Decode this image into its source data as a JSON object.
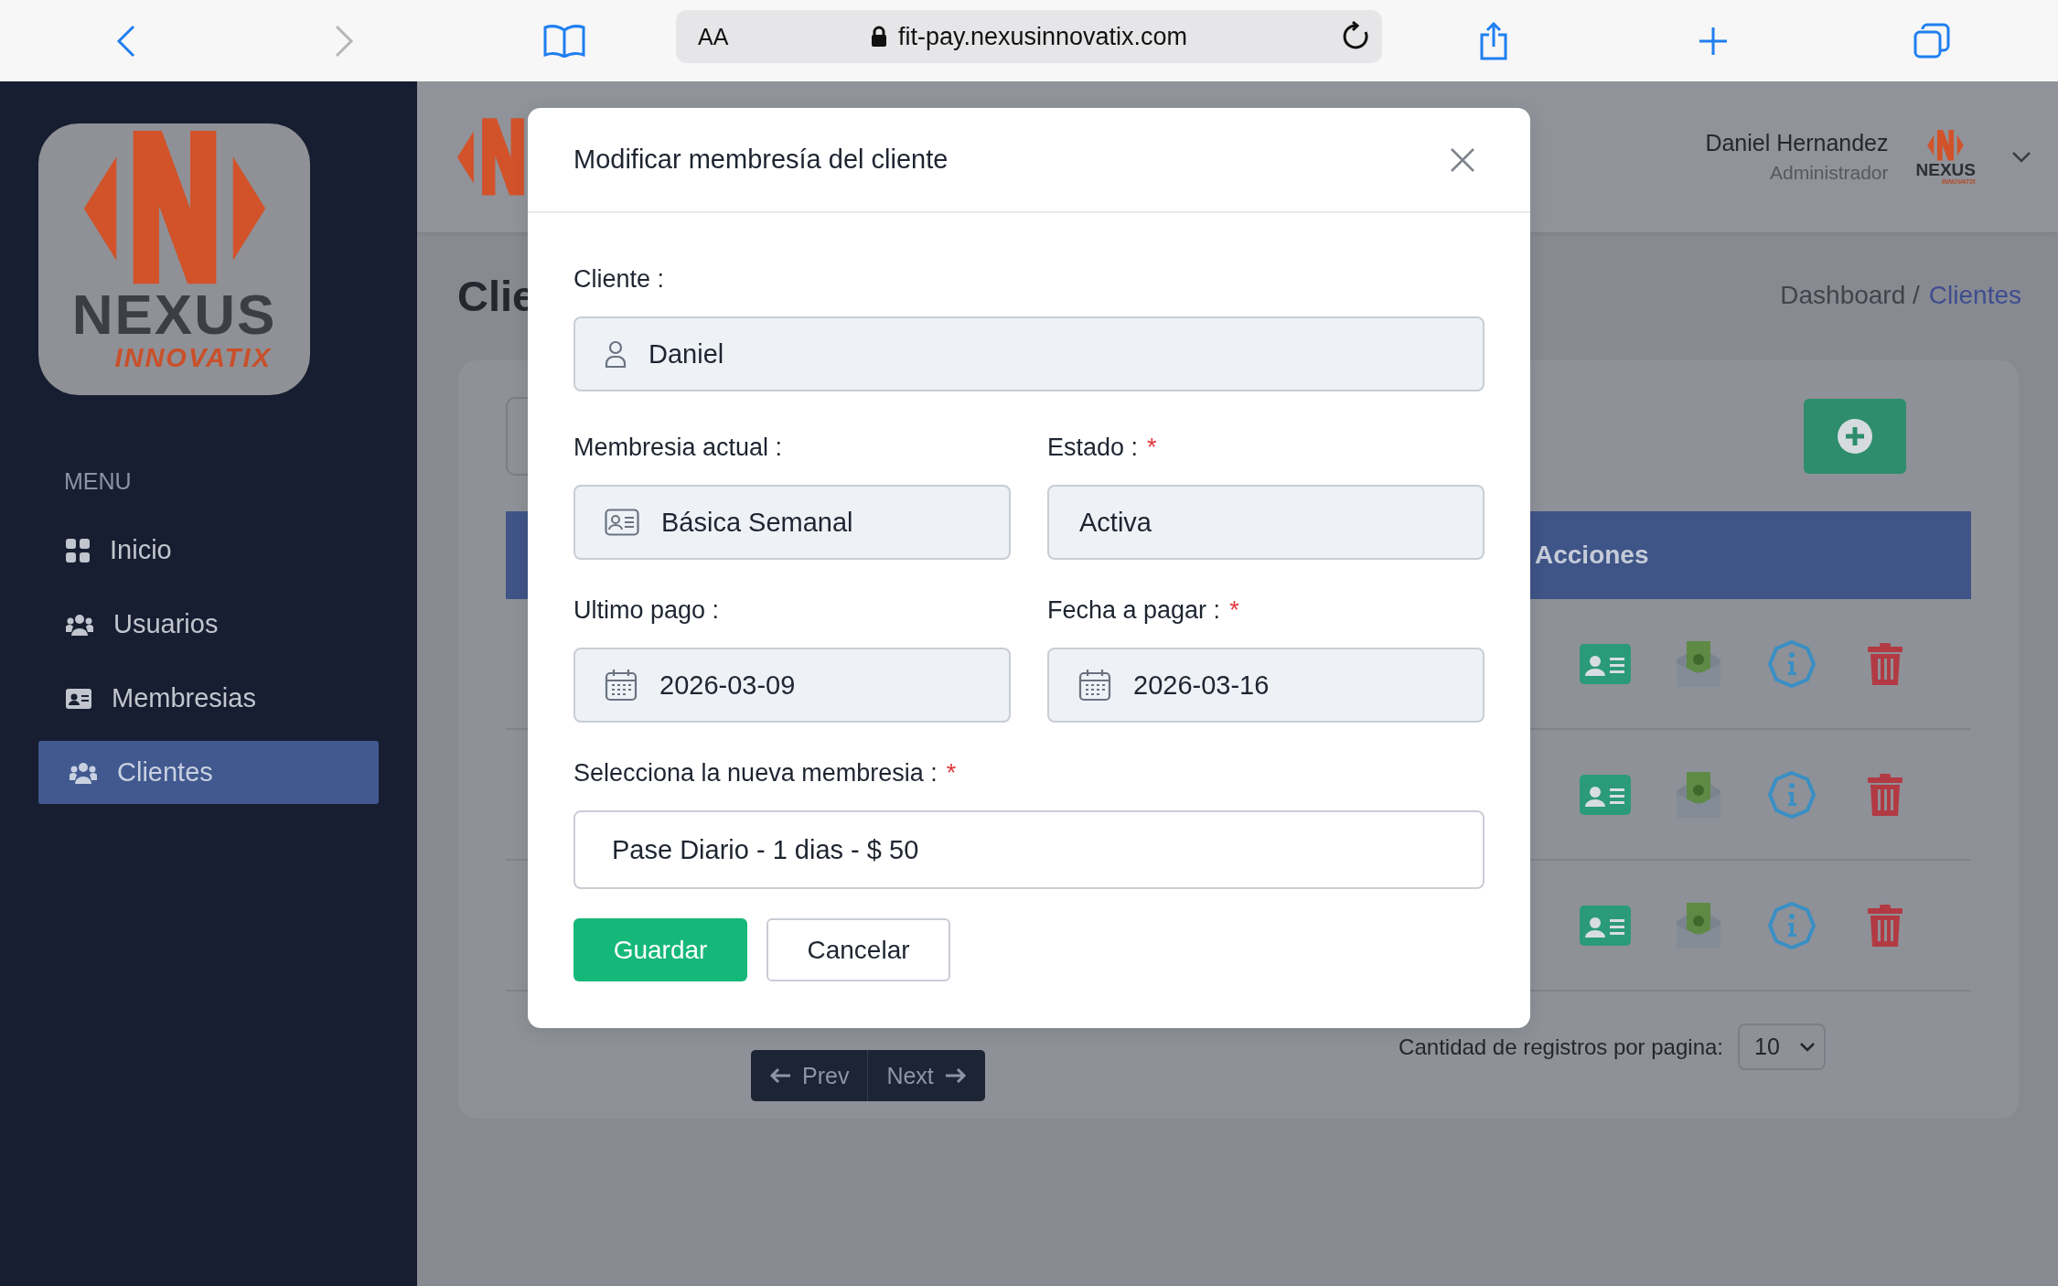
{
  "browser": {
    "text_size_button": "AA",
    "url": "fit-pay.nexusinnovatix.com"
  },
  "sidebar": {
    "logo": {
      "wordmark": "NEXUS",
      "tagline": "INNOVATIX"
    },
    "menu_heading": "MENU",
    "items": [
      {
        "label": "Inicio",
        "selected": false
      },
      {
        "label": "Usuarios",
        "selected": false
      },
      {
        "label": "Membresias",
        "selected": false
      },
      {
        "label": "Clientes",
        "selected": true
      }
    ]
  },
  "header": {
    "user_name": "Daniel Hernandez",
    "user_role": "Administrador",
    "avatar": {
      "wordmark": "NEXUS",
      "tagline": "INNOVATIX"
    }
  },
  "page": {
    "title": "Clie",
    "breadcrumb": [
      {
        "label": "Dashboard /",
        "selected": false
      },
      {
        "label": "Clientes",
        "selected": true
      }
    ]
  },
  "table": {
    "columns": [
      {
        "label": "Acciones"
      }
    ],
    "rows": [
      {
        "kind": "client"
      },
      {
        "kind": "client"
      },
      {
        "kind": "client"
      }
    ]
  },
  "pagination": {
    "prev": "Prev",
    "next": "Next",
    "page_size_label": "Cantidad de registros por pagina:",
    "page_size": "10"
  },
  "modal": {
    "title": "Modificar membresía del cliente",
    "rows": [
      [
        {
          "label": "Cliente :",
          "kind": "readonly",
          "value": "Daniel"
        }
      ],
      [
        {
          "label": "Membresia actual :",
          "kind": "readonly",
          "value": "Básica Semanal"
        },
        {
          "label": "Estado :",
          "required_mark": "*",
          "kind": "readonly",
          "value": "Activa"
        }
      ],
      [
        {
          "label": "Ultimo pago :",
          "kind": "readonly",
          "value": "2026-03-09"
        },
        {
          "label": "Fecha a pagar :",
          "required_mark": "*",
          "kind": "readonly",
          "value": "2026-03-16"
        }
      ],
      [
        {
          "label": "Selecciona la nueva membresia :",
          "required_mark": "*",
          "kind": "select",
          "value": "Pase Diario - 1 dias - $ 50"
        }
      ]
    ],
    "buttons": [
      {
        "label": "Guardar",
        "kind": "primary"
      },
      {
        "label": "Cancelar",
        "kind": "secondary"
      }
    ]
  }
}
